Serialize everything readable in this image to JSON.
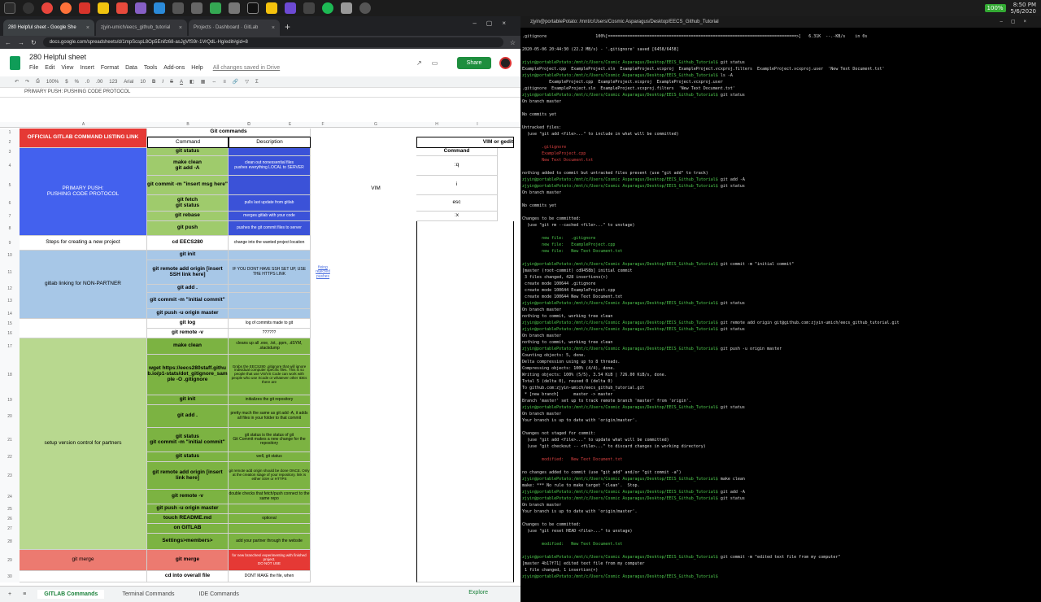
{
  "taskbar": {
    "battery": "100%",
    "time": "8:50 PM",
    "date": "5/6/2020"
  },
  "browser": {
    "tabs": [
      {
        "label": "280 Helpful sheet - Google She",
        "active": true
      },
      {
        "label": "zjyin-umich/eecs_github_tutorial"
      },
      {
        "label": "Projects · Dashboard · GitLab"
      }
    ],
    "url": "docs.google.com/spreadsheets/d/1mpScspL8Op5Enifz68-asJgVfS9r-1VrQdL-Hg/edit#gid=8"
  },
  "sheet": {
    "title": "280 Helpful sheet",
    "menu": [
      "File",
      "Edit",
      "View",
      "Insert",
      "Format",
      "Data",
      "Tools",
      "Add-ons",
      "Help"
    ],
    "saved": "All changes saved in Drive",
    "share": "Share",
    "toolbar": [
      "100%",
      "$",
      "%",
      ".0",
      ".00",
      "123",
      "Arial",
      "10",
      "B",
      "I",
      "S",
      "A"
    ],
    "formula": "PRIMARY PUSH: PUSHING CODE PROTOCOL",
    "columns": [
      "A",
      "B",
      "C",
      "D",
      "E",
      "F",
      "G",
      "H",
      "I"
    ],
    "rows": [
      "1",
      "2",
      "3",
      "4",
      "5",
      "6",
      "7",
      "8",
      "9",
      "10",
      "11",
      "12",
      "13",
      "14",
      "15",
      "16",
      "17",
      "18",
      "19",
      "20",
      "21",
      "22",
      "23",
      "24",
      "25",
      "26",
      "27",
      "28",
      "29",
      "30"
    ],
    "gitlab_link": "OFFICIAL GITLAB COMMAND LISTING LINK",
    "git_commands_header": "Git commands",
    "command_header": "Command",
    "description_header": "Description",
    "vim_header": "VIM or gedit",
    "vim_command_header": "Command",
    "vim_label": "VIM",
    "vim_cmds": [
      ":q",
      "i",
      "esc",
      ":x"
    ],
    "primary_push": "PRIMARY PUSH:\nPUSHING CODE PROTOCOL",
    "steps_label": "Steps for creating a new project",
    "gitlab_linking": "gitlab linking for NON-PARTNER",
    "setup_partners": "setup version control for partners",
    "git_merge_label": "git merge",
    "fixing_link": "fixing rejected pushes",
    "commands": [
      {
        "cmd": "git status",
        "desc": ""
      },
      {
        "cmd": "make clean\ngit add -A",
        "desc": "clean out nonessential files\npushes everything LOCAL to SERVER"
      },
      {
        "cmd": "git commit -m \"insert msg here\"",
        "desc": ""
      },
      {
        "cmd": "git fetch\ngit status",
        "desc": "pulls last update from gitlab"
      },
      {
        "cmd": "git rebase",
        "desc": "merges gitlab with your code"
      },
      {
        "cmd": "git push",
        "desc": "pushes the git commit files to server"
      },
      {
        "cmd": "cd EECS280",
        "desc": "change into the wanted project location"
      },
      {
        "cmd": "git init",
        "desc": ""
      },
      {
        "cmd": "git remote add origin [insert SSH link here]",
        "desc": "IF YOU DONT HAVE SSH SET UP, USE THE HTTPS LINK"
      },
      {
        "cmd": "git add .",
        "desc": ""
      },
      {
        "cmd": "git commit -m \"initial commit\"",
        "desc": ""
      },
      {
        "cmd": "git push -u origin master",
        "desc": ""
      },
      {
        "cmd": "git log",
        "desc": "log of commits made to git"
      },
      {
        "cmd": "git remote -v",
        "desc": "??????"
      },
      {
        "cmd": "make clean",
        "desc": "cleans up all .exe, .txt, .ppm, .dSYM, .stackdump"
      },
      {
        "cmd": "wget https://eecs280staff.github.io/p1-stats/dot_gitignore_sample -O .gitignore",
        "desc": "Grabs the EECS280 .gitignore that will ignore individual computer specific files. This is so people that use VS/VS Code can work with people who use Xcode or whatever other IDEs there are"
      },
      {
        "cmd": "git init",
        "desc": "initializes the git repository"
      },
      {
        "cmd": "git add .",
        "desc": "pretty much the same as git add -A, it adds all files in your folder to that commit"
      },
      {
        "cmd": "git status\ngit commit -m \"initial commit\"",
        "desc": "git status is the status of git\nGit Commit makes a new change for the repository"
      },
      {
        "cmd": "git status",
        "desc": "well, git status"
      },
      {
        "cmd": "git remote add origin [insert link here]",
        "desc": "git remote add origin should be done ONCE. Only at the creation stage of your repository. link is either SSH or HTTPS"
      },
      {
        "cmd": "git remote -v",
        "desc": "double checks that fetch/push connect to the same repo"
      },
      {
        "cmd": "git push -u origin master",
        "desc": ""
      },
      {
        "cmd": "touch README.md",
        "desc": "optional"
      },
      {
        "cmd": "on GITLAB",
        "desc": ""
      },
      {
        "cmd": "Settings>members>",
        "desc": "add your partner through the website"
      },
      {
        "cmd": "git merge",
        "desc": "for new branches/ experimenting with finished project.\nDO NOT USE"
      },
      {
        "cmd": "cd into overall file",
        "desc": "DONT MAKE the file, when"
      }
    ],
    "sheet_tabs": [
      "GITLAB Commands",
      "Terminal Commands",
      "IDE Commands"
    ],
    "explore": "Explore"
  },
  "terminal": {
    "title": "zjyin@portablePotato: /mnt/c/Users/Cosmic Asparagus/Desktop/EECS_Github_Tutorial",
    "prompt": "zjyin@portablePotato:/mnt/c/Users/Cosmic Asparagus/Desktop/EECS_Github_Tutorial$",
    "lines": [
      {
        "t": ".gitignore                    100%[=============================================================================>]   6.31K  --.-KB/s    in 0s",
        "c": "wh"
      },
      {
        "t": "",
        "c": "wh"
      },
      {
        "t": "2020-05-06 20:44:30 (22.2 MB/s) - '.gitignore' saved [6458/6458]",
        "c": "wh"
      },
      {
        "t": "",
        "c": "wh"
      },
      {
        "t": "P git status",
        "c": "g"
      },
      {
        "t": "ExampleProject.cpp  ExampleProject.sln  ExampleProject.vcxproj  ExampleProject.vcxproj.filters  ExampleProject.vcxproj.user  'New Text Document.txt'",
        "c": "wh"
      },
      {
        "t": "P ls -A",
        "c": "g"
      },
      {
        "t": "           ExampleProject.cpp  ExampleProject.vcxproj  ExampleProject.vcxproj.user",
        "c": "wh"
      },
      {
        "t": ".gitignore  ExampleProject.sln  ExampleProject.vcxproj.filters  'New Text Document.txt'",
        "c": "wh"
      },
      {
        "t": "P git status",
        "c": "g"
      },
      {
        "t": "On branch master",
        "c": "wh"
      },
      {
        "t": "",
        "c": "wh"
      },
      {
        "t": "No commits yet",
        "c": "wh"
      },
      {
        "t": "",
        "c": "wh"
      },
      {
        "t": "Untracked files:",
        "c": "wh"
      },
      {
        "t": "  (use \"git add <file>...\" to include in what will be committed)",
        "c": "wh"
      },
      {
        "t": "",
        "c": "wh"
      },
      {
        "t": "        .gitignore",
        "c": "r"
      },
      {
        "t": "        ExampleProject.cpp",
        "c": "r"
      },
      {
        "t": "        New Text Document.txt",
        "c": "r"
      },
      {
        "t": "",
        "c": "wh"
      },
      {
        "t": "nothing added to commit but untracked files present (use \"git add\" to track)",
        "c": "wh"
      },
      {
        "t": "P git add -A",
        "c": "g"
      },
      {
        "t": "P git status",
        "c": "g"
      },
      {
        "t": "On branch master",
        "c": "wh"
      },
      {
        "t": "",
        "c": "wh"
      },
      {
        "t": "No commits yet",
        "c": "wh"
      },
      {
        "t": "",
        "c": "wh"
      },
      {
        "t": "Changes to be committed:",
        "c": "wh"
      },
      {
        "t": "  (use \"git rm --cached <file>...\" to unstage)",
        "c": "wh"
      },
      {
        "t": "",
        "c": "wh"
      },
      {
        "t": "        new file:   .gitignore",
        "c": "g"
      },
      {
        "t": "        new file:   ExampleProject.cpp",
        "c": "g"
      },
      {
        "t": "        new file:   New Text Document.txt",
        "c": "g"
      },
      {
        "t": "",
        "c": "wh"
      },
      {
        "t": "P git commit -m \"initial commit\"",
        "c": "g"
      },
      {
        "t": "[master (root-commit) cd9458b] initial commit",
        "c": "wh"
      },
      {
        "t": " 3 files changed, 428 insertions(+)",
        "c": "wh"
      },
      {
        "t": " create mode 100644 .gitignore",
        "c": "wh"
      },
      {
        "t": " create mode 100644 ExampleProject.cpp",
        "c": "wh"
      },
      {
        "t": " create mode 100644 New Text Document.txt",
        "c": "wh"
      },
      {
        "t": "P git status",
        "c": "g"
      },
      {
        "t": "On branch master",
        "c": "wh"
      },
      {
        "t": "nothing to commit, working tree clean",
        "c": "wh"
      },
      {
        "t": "P git remote add origin git@github.com:zjyin-umich/eecs_github_tutorial.git",
        "c": "g"
      },
      {
        "t": "P git status",
        "c": "g"
      },
      {
        "t": "On branch master",
        "c": "wh"
      },
      {
        "t": "nothing to commit, working tree clean",
        "c": "wh"
      },
      {
        "t": "P git push -u origin master",
        "c": "g"
      },
      {
        "t": "Counting objects: 5, done.",
        "c": "wh"
      },
      {
        "t": "Delta compression using up to 8 threads.",
        "c": "wh"
      },
      {
        "t": "Compressing objects: 100% (4/4), done.",
        "c": "wh"
      },
      {
        "t": "Writing objects: 100% (5/5), 3.54 KiB | 726.00 KiB/s, done.",
        "c": "wh"
      },
      {
        "t": "Total 5 (delta 0), reused 0 (delta 0)",
        "c": "wh"
      },
      {
        "t": "To github.com:zjyin-umich/eecs_github_tutorial.git",
        "c": "wh"
      },
      {
        "t": " * [new branch]      master -> master",
        "c": "wh"
      },
      {
        "t": "Branch 'master' set up to track remote branch 'master' from 'origin'.",
        "c": "wh"
      },
      {
        "t": "P git status",
        "c": "g"
      },
      {
        "t": "On branch master",
        "c": "wh"
      },
      {
        "t": "Your branch is up to date with 'origin/master'.",
        "c": "wh"
      },
      {
        "t": "",
        "c": "wh"
      },
      {
        "t": "Changes not staged for commit:",
        "c": "wh"
      },
      {
        "t": "  (use \"git add <file>...\" to update what will be committed)",
        "c": "wh"
      },
      {
        "t": "  (use \"git checkout -- <file>...\" to discard changes in working directory)",
        "c": "wh"
      },
      {
        "t": "",
        "c": "wh"
      },
      {
        "t": "        modified:   New Text Document.txt",
        "c": "r"
      },
      {
        "t": "",
        "c": "wh"
      },
      {
        "t": "no changes added to commit (use \"git add\" and/or \"git commit -a\")",
        "c": "wh"
      },
      {
        "t": "P make clean",
        "c": "g"
      },
      {
        "t": "make: *** No rule to make target 'clean'.  Stop.",
        "c": "wh"
      },
      {
        "t": "P git add -A",
        "c": "g"
      },
      {
        "t": "P git status",
        "c": "g"
      },
      {
        "t": "On branch master",
        "c": "wh"
      },
      {
        "t": "Your branch is up to date with 'origin/master'.",
        "c": "wh"
      },
      {
        "t": "",
        "c": "wh"
      },
      {
        "t": "Changes to be committed:",
        "c": "wh"
      },
      {
        "t": "  (use \"git reset HEAD <file>...\" to unstage)",
        "c": "wh"
      },
      {
        "t": "",
        "c": "wh"
      },
      {
        "t": "        modified:   New Text Document.txt",
        "c": "g"
      },
      {
        "t": "",
        "c": "wh"
      },
      {
        "t": "P git commit -m \"edited text file from my computer\"",
        "c": "g"
      },
      {
        "t": "[master 4b17f71] edited text file from my computer",
        "c": "wh"
      },
      {
        "t": " 1 file changed, 1 insertion(+)",
        "c": "wh"
      },
      {
        "t": "P ",
        "c": "g"
      }
    ]
  }
}
